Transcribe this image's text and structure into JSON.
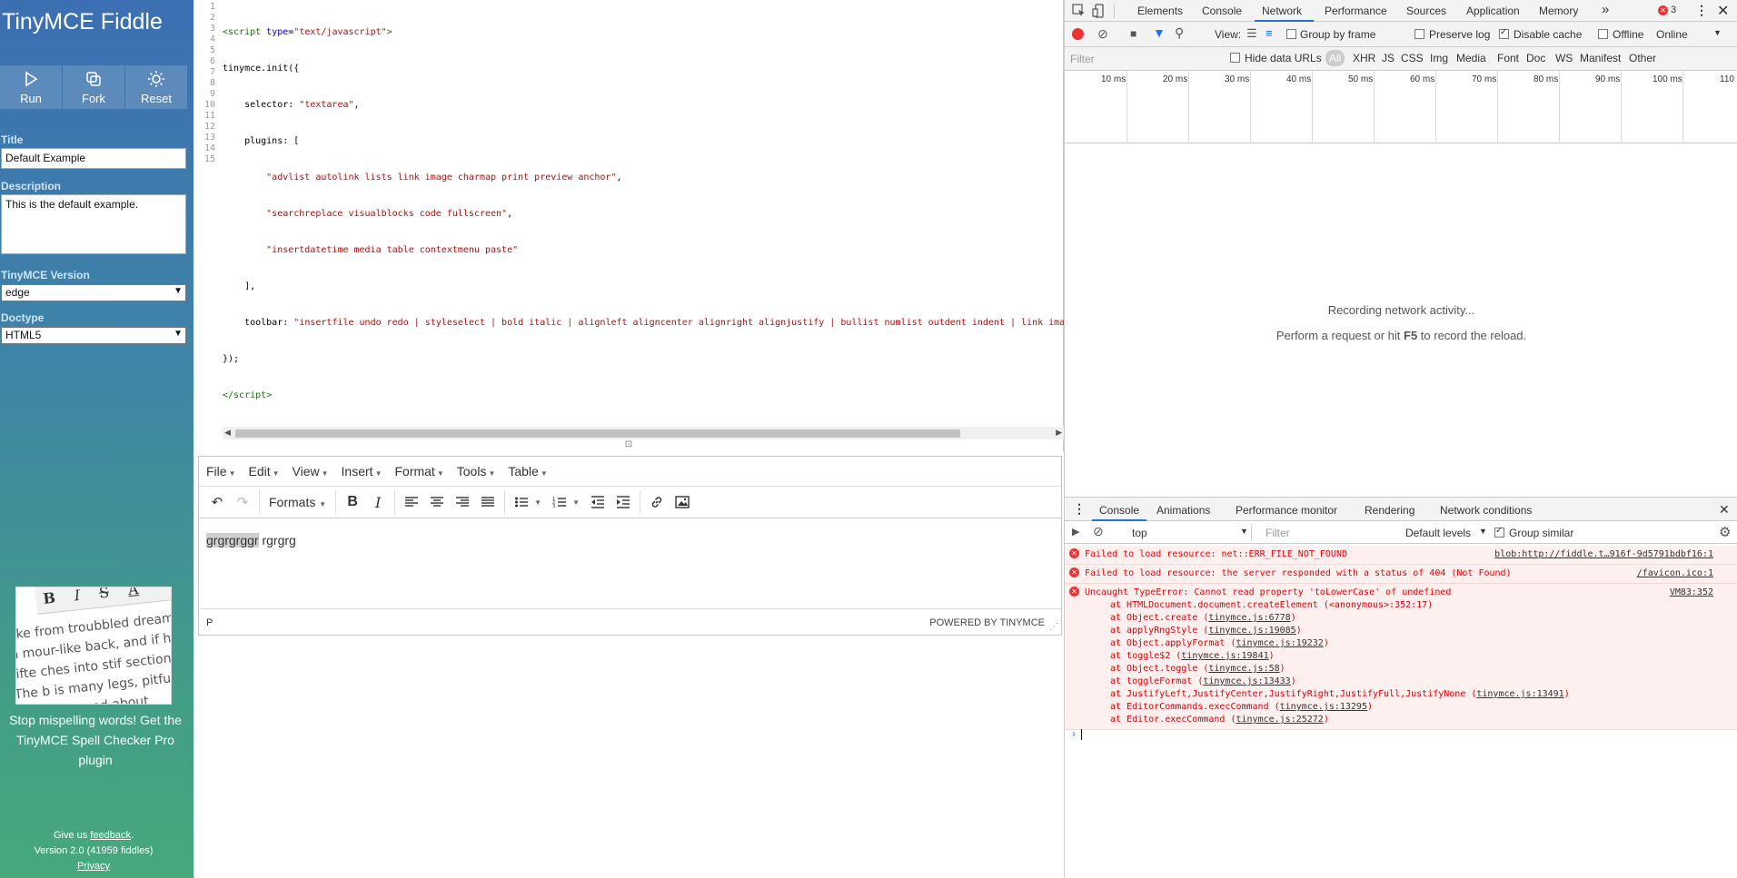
{
  "sidebar": {
    "brand": "TinyMCE Fiddle",
    "actions": [
      {
        "label": "Run"
      },
      {
        "label": "Fork"
      },
      {
        "label": "Reset"
      }
    ],
    "title_label": "Title",
    "title_value": "Default Example",
    "description_label": "Description",
    "description_value": "This is the default example.",
    "version_label": "TinyMCE Version",
    "version_value": "edge",
    "doctype_label": "Doctype",
    "doctype_value": "HTML5",
    "promo": {
      "toolbar_glyphs": [
        "B",
        "I",
        "S",
        "A"
      ],
      "sample_text": "oke from troubbled dreams, h mour-like back, and if he lifte ches into stif sections. The b is many legs, pitfully thin con raved about helplessly as he l",
      "text": "Stop mispelling words! Get the TinyMCE Spell Checker Pro plugin"
    },
    "footer": {
      "give_us": "Give us",
      "feedback_link": "feedback",
      "period": ".",
      "version": "Version 2.0 (41959 fiddles)",
      "privacy": "Privacy"
    }
  },
  "code_editor": {
    "line_numbers": [
      "1",
      "2",
      "3",
      "4",
      "5",
      "6",
      "7",
      "8",
      "9",
      "10",
      "11",
      "12",
      "13",
      "14",
      "15"
    ]
  },
  "editor": {
    "menus": [
      "File",
      "Edit",
      "View",
      "Insert",
      "Format",
      "Tools",
      "Table"
    ],
    "formats_label": "Formats",
    "content_selected": "grgrgrggr",
    "content_rest": " rgrgrg",
    "status_path": "P",
    "powered_by": "POWERED BY TINYMCE"
  },
  "devtools": {
    "tabs": [
      "Elements",
      "Console",
      "Network",
      "Performance",
      "Sources",
      "Application",
      "Memory"
    ],
    "active_tab": "Network",
    "more_tabs": "»",
    "error_count": "3",
    "network_toolbar": {
      "view_label": "View:",
      "group_by_frame": "Group by frame",
      "preserve_log": "Preserve log",
      "disable_cache": "Disable cache",
      "offline": "Offline",
      "throttle": "Online"
    },
    "filter_placeholder": "Filter",
    "hide_data_urls": "Hide data URLs",
    "type_filters": [
      "All",
      "XHR",
      "JS",
      "CSS",
      "Img",
      "Media",
      "Font",
      "Doc",
      "WS",
      "Manifest",
      "Other"
    ],
    "timeline_ticks": [
      "10 ms",
      "20 ms",
      "30 ms",
      "40 ms",
      "50 ms",
      "60 ms",
      "70 ms",
      "80 ms",
      "90 ms",
      "100 ms",
      "110"
    ],
    "recording": {
      "line1": "Recording network activity...",
      "line2_pre": "Perform a request or hit ",
      "line2_key": "F5",
      "line2_post": " to record the reload."
    },
    "drawer_tabs": [
      "Console",
      "Animations",
      "Performance monitor",
      "Rendering",
      "Network conditions"
    ],
    "console_toolbar": {
      "context": "top",
      "filter_placeholder": "Filter",
      "levels": "Default levels",
      "group_similar": "Group similar"
    },
    "messages": [
      {
        "text": "Failed to load resource: net::ERR_FILE_NOT_FOUND",
        "source": "blob:http://fiddle.t…916f-9d5791bdbf16:1"
      },
      {
        "text": "Failed to load resource: the server responded with a status of 404 (Not Found)",
        "source": "/favicon.ico:1"
      },
      {
        "text": "Uncaught TypeError: Cannot read property 'toLowerCase' of undefined",
        "source": "VM83:352",
        "stack": [
          {
            "pre": "at HTMLDocument.document.createElement (<anonymous>:352:17)",
            "link": ""
          },
          {
            "pre": "at Object.create (",
            "link": "tinymce.js:6778",
            "post": ")"
          },
          {
            "pre": "at applyRngStyle (",
            "link": "tinymce.js:19085",
            "post": ")"
          },
          {
            "pre": "at Object.applyFormat (",
            "link": "tinymce.js:19232",
            "post": ")"
          },
          {
            "pre": "at toggle$2 (",
            "link": "tinymce.js:19841",
            "post": ")"
          },
          {
            "pre": "at Object.toggle (",
            "link": "tinymce.js:58",
            "post": ")"
          },
          {
            "pre": "at toggleFormat (",
            "link": "tinymce.js:13433",
            "post": ")"
          },
          {
            "pre": "at JustifyLeft,JustifyCenter,JustifyRight,JustifyFull,JustifyNone (",
            "link": "tinymce.js:13491",
            "post": ")"
          },
          {
            "pre": "at EditorCommands.execCommand (",
            "link": "tinymce.js:13295",
            "post": ")"
          },
          {
            "pre": "at Editor.execCommand (",
            "link": "tinymce.js:25272",
            "post": ")"
          }
        ]
      }
    ],
    "prompt": "›"
  }
}
